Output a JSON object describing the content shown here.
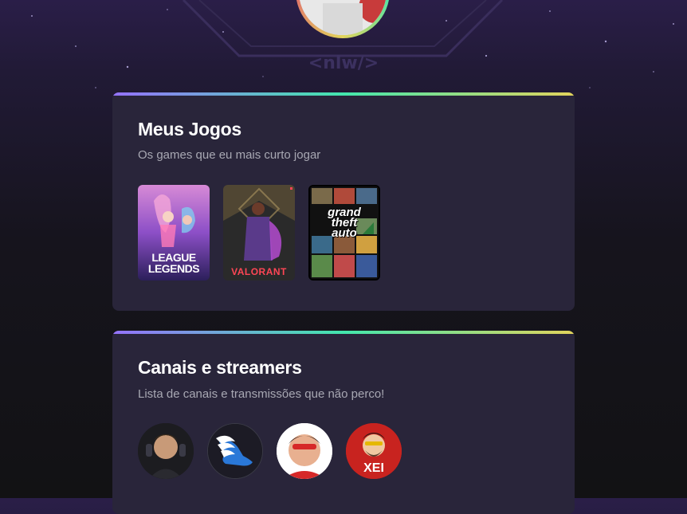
{
  "profile": {
    "avatar_icon": "user-avatar"
  },
  "background": {
    "logo_text": "<nlw/>"
  },
  "games_section": {
    "title": "Meus Jogos",
    "subtitle": "Os games que eu mais curto jogar",
    "games": [
      {
        "name": "LEAGUE OF LEGENDS",
        "line1": "LEAGUE",
        "line2": "LEGENDS"
      },
      {
        "name": "VALORANT"
      },
      {
        "name": "Grand Theft Auto V",
        "line1": "grand",
        "line2": "theft",
        "line3": "auto"
      }
    ]
  },
  "streamers_section": {
    "title": "Canais e streamers",
    "subtitle": "Lista de canais e transmissões que não perco!",
    "streamers": [
      {
        "icon": "streamer-avatar-1"
      },
      {
        "icon": "winged-shoe-logo"
      },
      {
        "icon": "streamer-avatar-3"
      },
      {
        "label": "XEI"
      }
    ]
  },
  "colors": {
    "card_bg": "#29253a",
    "gradient": [
      "#9572fc",
      "#43e7ad",
      "#e2d45c"
    ],
    "text_primary": "#ffffff",
    "text_secondary": "#a8a8b3"
  }
}
